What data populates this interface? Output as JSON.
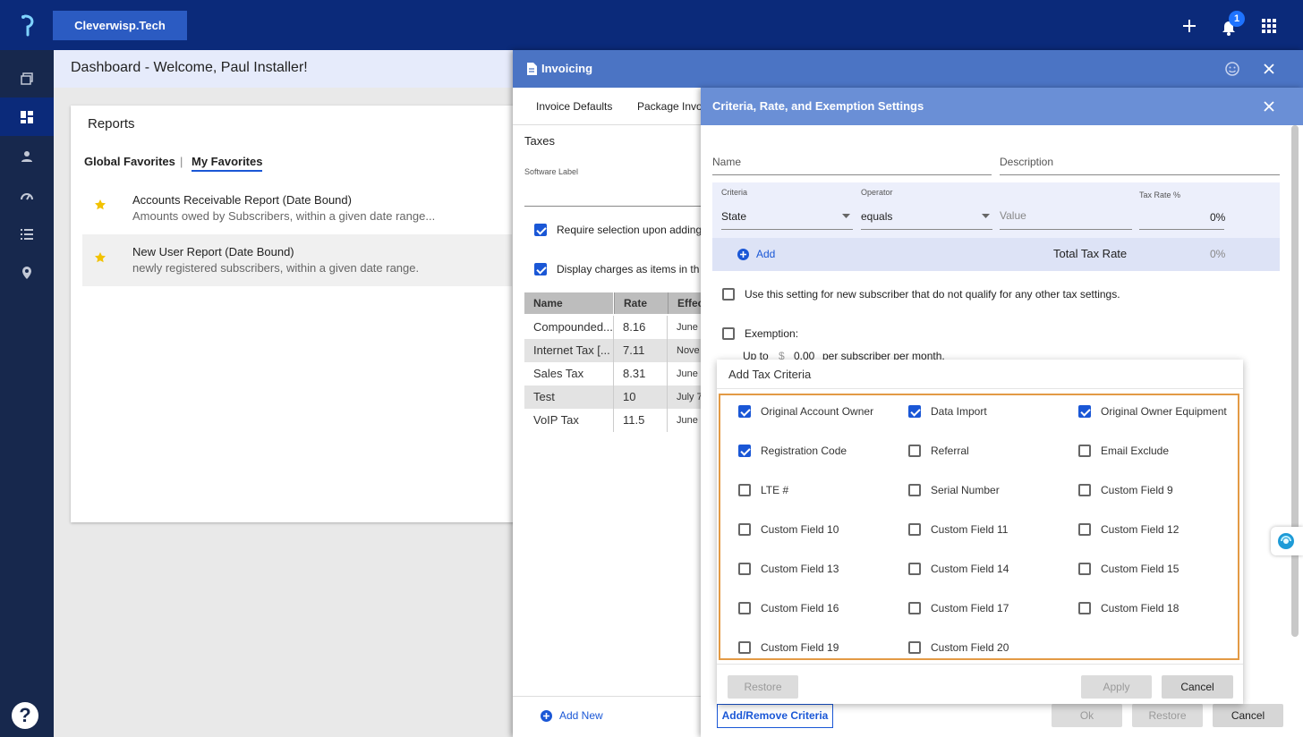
{
  "topbar": {
    "brand": "Cleverwisp.Tech",
    "notification_count": "1",
    "icons": [
      "logo-icon",
      "plus-icon",
      "bell-icon",
      "apps-grid-icon"
    ]
  },
  "sidenav": {
    "items": [
      "layers-icon",
      "dashboard-icon",
      "person-icon",
      "gauge-icon",
      "list-icon",
      "location-icon"
    ],
    "active": "dashboard-icon",
    "help": "?"
  },
  "dashboard": {
    "title": "Dashboard - Welcome, Paul Installer!",
    "reports_title": "Reports",
    "tabs": [
      "Global Favorites",
      "|",
      "My Favorites"
    ],
    "reports": [
      {
        "name": "Accounts Receivable Report (Date Bound)",
        "desc": "Amounts owed by Subscribers, within a given date range..."
      },
      {
        "name": "New User Report (Date Bound)",
        "desc": "newly registered subscribers, within a given date range."
      }
    ]
  },
  "invoicing": {
    "title": "Invoicing",
    "tabs": [
      "Invoice Defaults",
      "Package Invo"
    ],
    "section": "Taxes",
    "software_label": "Software Label",
    "options": [
      {
        "label": "Require selection upon adding",
        "checked": true
      },
      {
        "label": "Display charges as items in th",
        "checked": true
      }
    ],
    "table": {
      "headers": [
        "Name",
        "Rate",
        "Effec"
      ],
      "rows": [
        [
          "Compounded...",
          "8.16",
          "June"
        ],
        [
          "Internet Tax [...",
          "7.11",
          "Nove"
        ],
        [
          "Sales Tax",
          "8.31",
          "June"
        ],
        [
          "Test",
          "10",
          "July 7"
        ],
        [
          "VoIP Tax",
          "11.5",
          "June"
        ]
      ]
    },
    "add_new": "Add New",
    "footer_buttons": [
      "Ok",
      "Restore",
      "Cancel"
    ]
  },
  "criteria": {
    "title": "Criteria, Rate, and Exemption Settings",
    "name_label": "Name",
    "description_label": "Description",
    "criteria_label": "Criteria",
    "criteria_value": "State",
    "operator_label": "Operator",
    "operator_value": "equals",
    "value_placeholder": "Value",
    "tax_rate_label": "Tax Rate %",
    "tax_rate_value": "0%",
    "add_label": "Add",
    "total_label": "Total Tax Rate",
    "total_value": "0%",
    "default_setting": "Use this setting for new subscriber that do not qualify for any other tax settings.",
    "exemption": "Exemption:",
    "up_to": "Up to",
    "currency": "$",
    "amount": "0.00",
    "per_month": "per subscriber per month.",
    "add_remove": "Add/Remove Criteria"
  },
  "popup": {
    "title": "Add Tax Criteria",
    "items": [
      {
        "label": "Original Account Owner",
        "checked": true
      },
      {
        "label": "Data Import",
        "checked": true
      },
      {
        "label": "Original Owner Equipment",
        "checked": true
      },
      {
        "label": "Registration Code",
        "checked": true
      },
      {
        "label": "Referral",
        "checked": false
      },
      {
        "label": "Email Exclude",
        "checked": false
      },
      {
        "label": "LTE #",
        "checked": false
      },
      {
        "label": "Serial Number",
        "checked": false
      },
      {
        "label": "Custom Field 9",
        "checked": false
      },
      {
        "label": "Custom Field 10",
        "checked": false
      },
      {
        "label": "Custom Field 11",
        "checked": false
      },
      {
        "label": "Custom Field 12",
        "checked": false
      },
      {
        "label": "Custom Field 13",
        "checked": false
      },
      {
        "label": "Custom Field 14",
        "checked": false
      },
      {
        "label": "Custom Field 15",
        "checked": false
      },
      {
        "label": "Custom Field 16",
        "checked": false
      },
      {
        "label": "Custom Field 17",
        "checked": false
      },
      {
        "label": "Custom Field 18",
        "checked": false
      },
      {
        "label": "Custom Field 19",
        "checked": false
      },
      {
        "label": "Custom Field 20",
        "checked": false
      }
    ],
    "buttons": {
      "restore": "Restore",
      "apply": "Apply",
      "cancel": "Cancel"
    }
  },
  "colors": {
    "topbar": "#0b2a7a",
    "sidenav": "#17284d",
    "accent": "#1a57d6",
    "invoicing_header": "#4b74c4",
    "criteria_header": "#6a8fd6",
    "popup_border": "#e39a45"
  }
}
